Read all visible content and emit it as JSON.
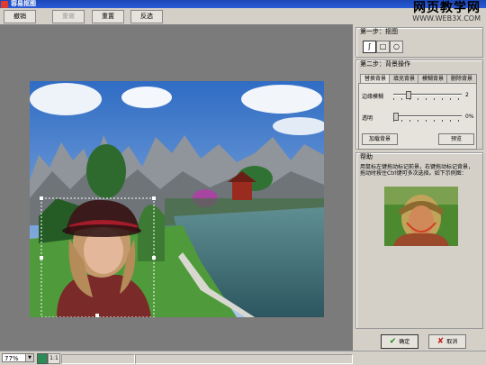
{
  "window": {
    "title": "容易抠图"
  },
  "watermark": {
    "line1": "网页教学网",
    "line2": "WWW.WEB3X.COM"
  },
  "toolbar": {
    "undo": "撤销",
    "redo": "重做",
    "reset": "重置",
    "invert": "反选"
  },
  "statusbar": {
    "zoom": "77%",
    "one_to_one": "1:1"
  },
  "step1": {
    "title": "第一步：抠图"
  },
  "step2": {
    "title": "第二步：背景操作",
    "tabs": [
      "替换背景",
      "填充背景",
      "模糊背景",
      "删除背景"
    ],
    "active_tab": 0,
    "edge_blur_label": "边缘模糊",
    "edge_blur_value": "2",
    "edge_blur_fraction": 0.2,
    "opacity_label": "透明",
    "opacity_value": "0%",
    "opacity_fraction": 0.0,
    "load_bg_button": "加载背景",
    "preview_button": "预览"
  },
  "help": {
    "title": "帮助",
    "text": "用鼠标左键拖动标记前景，右键拖动标记背景，拖动时按住Ctrl键可多次选择。如下示例图："
  },
  "actions": {
    "ok": "确定",
    "cancel": "取消"
  },
  "icons": {
    "app": "app-logo-icon",
    "fit": "fit-window-icon",
    "ok": "checkmark-icon",
    "cancel": "cross-icon"
  },
  "colors": {
    "titlebar": "#2a5bd6",
    "canvas_bg": "#7b7b7b",
    "panel_bg": "#d4d0c8"
  }
}
